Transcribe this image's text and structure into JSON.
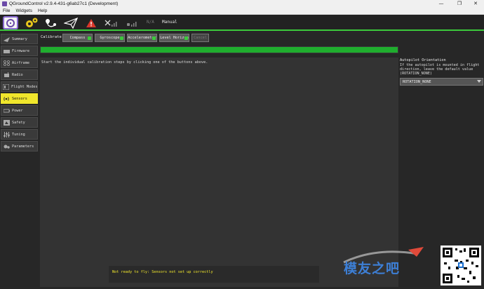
{
  "window": {
    "title": "QGroundControl v2.9.4-431-g6ab27c1 (Development)",
    "minimize": "—",
    "maximize": "❐",
    "close": "✕"
  },
  "menu": [
    "File",
    "Widgets",
    "Help"
  ],
  "toolbar": {
    "gps_count": "N/A",
    "flight_mode": "Manual"
  },
  "sidebar": [
    {
      "label": "Summary",
      "icon": "summary-icon",
      "active": false
    },
    {
      "label": "Firmware",
      "icon": "firmware-icon",
      "active": false
    },
    {
      "label": "Airframe",
      "icon": "airframe-icon",
      "active": false
    },
    {
      "label": "Radio",
      "icon": "radio-icon",
      "active": false
    },
    {
      "label": "Flight Modes",
      "icon": "flight-modes-icon",
      "active": false
    },
    {
      "label": "Sensors",
      "icon": "sensors-icon",
      "active": true
    },
    {
      "label": "Power",
      "icon": "power-icon",
      "active": false
    },
    {
      "label": "Safety",
      "icon": "safety-icon",
      "active": false
    },
    {
      "label": "Tuning",
      "icon": "tuning-icon",
      "active": false
    },
    {
      "label": "Parameters",
      "icon": "parameters-icon",
      "active": false
    }
  ],
  "calibrate": {
    "label": "Calibrate:",
    "buttons": [
      {
        "label": "Compass",
        "done": true
      },
      {
        "label": "Gyroscope",
        "done": true
      },
      {
        "label": "Accelerometer",
        "done": true
      },
      {
        "label": "Level Horizon",
        "done": true
      },
      {
        "label": "Cancel",
        "done": false
      }
    ]
  },
  "progress": 1.0,
  "instructions": "Start the individual calibration steps by clicking one of the buttons above.",
  "status_message": "Not ready to fly: Sensors not set up correctly",
  "orientation": {
    "title": "Autopilot Orientation",
    "description": "If the autopilot is mounted in flight direction, leave the default value (ROTATION_NONE)",
    "selected": "ROTATION_NONE"
  },
  "watermark": "模友之吧",
  "colors": {
    "accent_green": "#3cc93c",
    "active_yellow": "#f0e62c",
    "progress_green": "#1fae2e",
    "warning_red": "#d9362b"
  }
}
